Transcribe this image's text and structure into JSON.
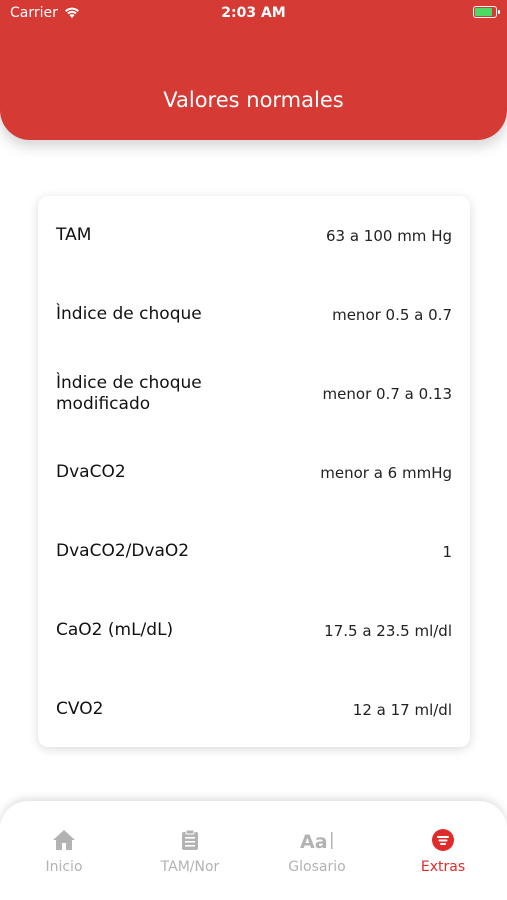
{
  "status_bar": {
    "carrier": "Carrier",
    "time": "2:03 AM"
  },
  "header": {
    "title": "Valores normales"
  },
  "rows": [
    {
      "label": "TAM",
      "value": "63 a 100 mm Hg"
    },
    {
      "label": "Ìndice de choque",
      "value": "menor 0.5 a 0.7"
    },
    {
      "label": "Ìndice de choque modificado",
      "value": "menor 0.7 a 0.13"
    },
    {
      "label": "DvaCO2",
      "value": "menor a 6 mmHg"
    },
    {
      "label": "DvaCO2/DvaO2",
      "value": "1"
    },
    {
      "label": "CaO2 (mL/dL)",
      "value": "17.5 a 23.5 ml/dl"
    },
    {
      "label": "CVO2",
      "value": "12 a 17 ml/dl"
    }
  ],
  "tabbar": {
    "items": [
      {
        "label": "Inicio",
        "icon": "home-icon"
      },
      {
        "label": "TAM/Nor",
        "icon": "clipboard-icon"
      },
      {
        "label": "Glosario",
        "icon": "text-aa-icon"
      },
      {
        "label": "Extras",
        "icon": "list-circle-icon"
      }
    ],
    "active": "Extras"
  },
  "colors": {
    "accent": "#d63a35",
    "inactive": "#b3b3b3",
    "active": "#e02b2b"
  }
}
